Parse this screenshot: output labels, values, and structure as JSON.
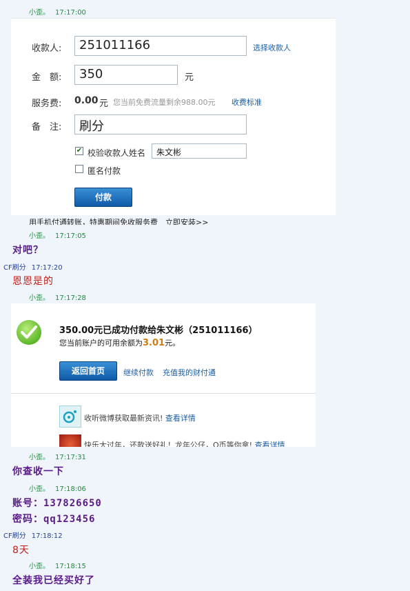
{
  "chat": {
    "m1": {
      "sender": "小歪。",
      "time": "17:17:00"
    },
    "m2": {
      "sender": "小歪。",
      "time": "17:17:05",
      "text": "对吧？"
    },
    "m3": {
      "sender": "CF刷分",
      "time": "17:17:20",
      "text": "恩恩是的"
    },
    "m4": {
      "sender": "小歪。",
      "time": "17:17:28"
    },
    "m5": {
      "sender": "小歪。",
      "time": "17:17:31",
      "text": "你查收一下"
    },
    "m6": {
      "sender": "小歪。",
      "time": "17:18:06",
      "line1": "账号：137826650",
      "line2": "密码：qq123456"
    },
    "m7": {
      "sender": "CF刷分",
      "time": "17:18:12",
      "text": "8天"
    },
    "m8": {
      "sender": "小歪。",
      "time": "17:18:15",
      "text": "全装我已经买好了"
    }
  },
  "payment_form": {
    "payee_label": "收款人:",
    "payee_value": "251011166",
    "choose_payee_link": "选择收款人",
    "amount_label": "金　额:",
    "amount_value": "350",
    "amount_unit": "元",
    "fee_label": "服务费:",
    "fee_value": "0.00",
    "fee_unit": "元",
    "fee_note": "您当前免费流量剩余988.00元",
    "fee_standard_link": "收费标准",
    "remark_label": "备　注:",
    "remark_value": "刷分",
    "verify_name_label": "校验收款人姓名",
    "verify_name_value": "朱文彬",
    "verify_checked": true,
    "anonymous_label": "匿名付款",
    "anonymous_checked": false,
    "pay_button": "付款",
    "bottom_cut_text": "用手机付通转账，特惠期间免收服务费　立即安装>>"
  },
  "success_panel": {
    "title": "350.00元已成功付款给朱文彬（251011166）",
    "balance_prefix": "您当前账户的可用余额为",
    "balance_amount": "3.01",
    "balance_suffix": "元。",
    "home_button": "返回首页",
    "continue_link": "继续付款",
    "recharge_link": "充值我的财付通",
    "info1_text": "收听微博获取最新资讯!",
    "info1_link": "查看详情",
    "info2_text": "快乐大过年，还款送好礼！龙年公仔，Q币等你拿!",
    "info2_link": "查看详情"
  },
  "colors": {
    "background": "#f0f5fb",
    "sender_self": "#1a8f3a",
    "sender_other": "#1f3fa0",
    "message_purple": "#5a1a8a",
    "message_red": "#c0201a",
    "link": "#1a5fa8",
    "button_blue": "#0e5aa8"
  }
}
